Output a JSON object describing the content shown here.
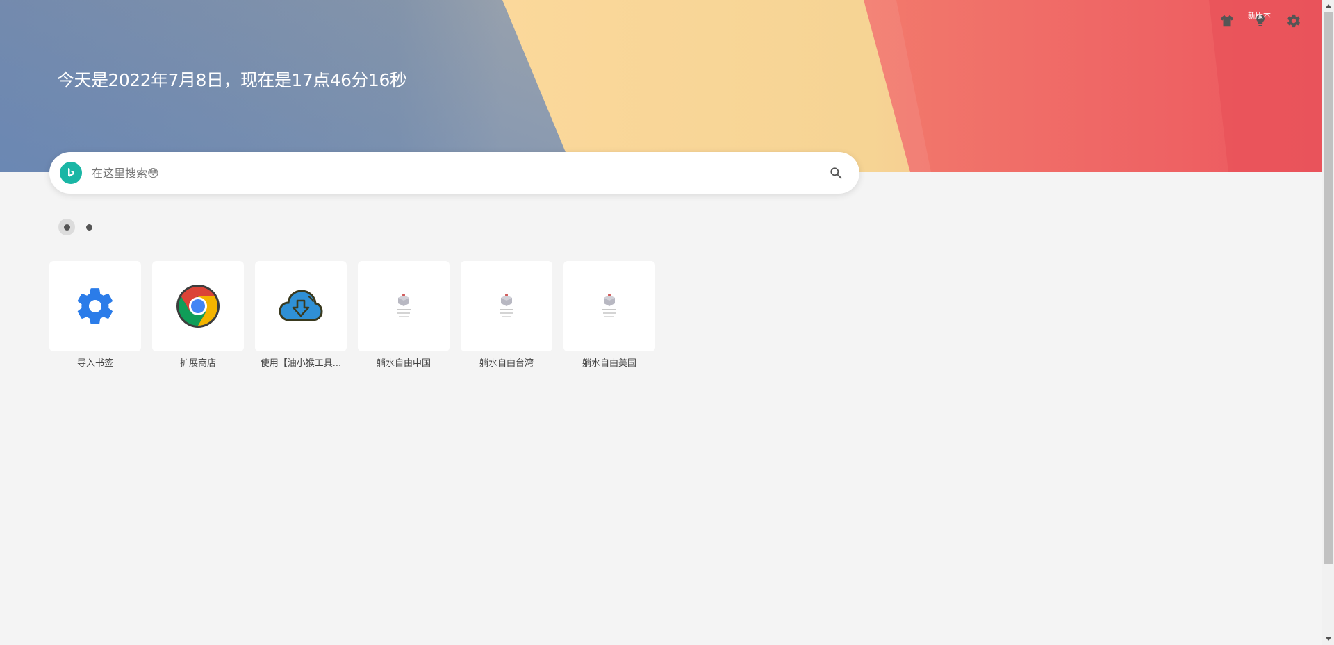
{
  "hero": {
    "datetime": "今天是2022年7月8日，现在是17点46分16秒"
  },
  "top_tools": {
    "new_version_badge": "新版本",
    "items": [
      {
        "name": "shirt-icon"
      },
      {
        "name": "lightbulb-icon"
      },
      {
        "name": "gear-icon"
      }
    ]
  },
  "search": {
    "engine_icon": "bing-logo-icon",
    "placeholder": "在这里搜索😳",
    "icon": "search-icon"
  },
  "pager": {
    "pages": 2,
    "active": 1
  },
  "shortcuts": [
    {
      "label": "导入书签",
      "icon": "gear-icon"
    },
    {
      "label": "扩展商店",
      "icon": "chrome-logo-icon"
    },
    {
      "label": "使用【油小猴工具...",
      "icon": "cloud-download-icon"
    },
    {
      "label": "躺水自由中国",
      "icon": "site-logo-icon"
    },
    {
      "label": "躺水自由台湾",
      "icon": "site-logo-icon"
    },
    {
      "label": "躺水自由美国",
      "icon": "site-logo-icon"
    }
  ],
  "colors": {
    "banner_gray": "#8896a8",
    "banner_yellow": "#fbd89b",
    "banner_red": "#ee5a5f",
    "engine_teal": "#1ab6a5",
    "gear_blue": "#2b7ce9"
  }
}
